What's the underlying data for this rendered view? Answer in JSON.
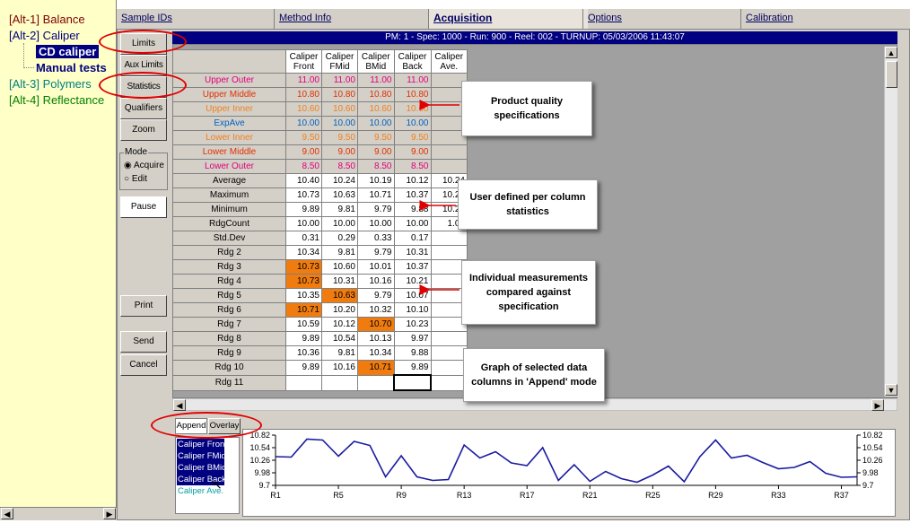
{
  "tree": [
    {
      "label": "[Alt-1] Balance",
      "color": "#800000"
    },
    {
      "label": "[Alt-2] Caliper",
      "color": "#000080"
    },
    {
      "label": "CD caliper",
      "color": "#ffffff",
      "selected": true
    },
    {
      "label": "Manual tests",
      "color": "#000080"
    },
    {
      "label": "[Alt-3] Polymers",
      "color": "#008080"
    },
    {
      "label": "[Alt-4] Reflectance",
      "color": "#008000"
    }
  ],
  "tabs": [
    "Sample IDs",
    "Method Info",
    "Acquisition",
    "Options",
    "Calibration"
  ],
  "buttons": {
    "limits": "Limits",
    "aux_limits": "Aux Limits",
    "statistics": "Statistics",
    "qualifiers": "Qualifiers",
    "zoom": "Zoom",
    "mode_label": "Mode",
    "acquire": "Acquire",
    "edit": "Edit",
    "pause": "Pause",
    "print": "Print",
    "send": "Send",
    "cancel": "Cancel",
    "append": "Append",
    "overlay": "Overlay"
  },
  "status_bar": "PM: 1 - Spec: 1000 - Run: 900 - Reel: 002 - TURNUP: 05/03/2006 11:43:07",
  "columns": [
    {
      "l1": "Caliper",
      "l2": "Front"
    },
    {
      "l1": "Caliper",
      "l2": "FMid"
    },
    {
      "l1": "Caliper",
      "l2": "BMid"
    },
    {
      "l1": "Caliper",
      "l2": "Back"
    },
    {
      "l1": "Caliper",
      "l2": "Ave."
    }
  ],
  "spec_rows": [
    {
      "label": "Upper Outer",
      "color": "#e0007a",
      "values": [
        "11.00",
        "11.00",
        "11.00",
        "11.00",
        ""
      ]
    },
    {
      "label": "Upper Middle",
      "color": "#e03000",
      "values": [
        "10.80",
        "10.80",
        "10.80",
        "10.80",
        ""
      ]
    },
    {
      "label": "Upper Inner",
      "color": "#f08020",
      "values": [
        "10.60",
        "10.60",
        "10.60",
        "10.60",
        ""
      ]
    },
    {
      "label": "ExpAve",
      "color": "#0060c0",
      "values": [
        "10.00",
        "10.00",
        "10.00",
        "10.00",
        ""
      ]
    },
    {
      "label": "Lower Inner",
      "color": "#f08020",
      "values": [
        "9.50",
        "9.50",
        "9.50",
        "9.50",
        ""
      ]
    },
    {
      "label": "Lower Middle",
      "color": "#e03000",
      "values": [
        "9.00",
        "9.00",
        "9.00",
        "9.00",
        ""
      ]
    },
    {
      "label": "Lower Outer",
      "color": "#e0007a",
      "values": [
        "8.50",
        "8.50",
        "8.50",
        "8.50",
        ""
      ]
    }
  ],
  "stat_rows": [
    {
      "label": "Average",
      "values": [
        "10.40",
        "10.24",
        "10.19",
        "10.12",
        "10.24"
      ]
    },
    {
      "label": "Maximum",
      "values": [
        "10.73",
        "10.63",
        "10.71",
        "10.37",
        "10.24"
      ]
    },
    {
      "label": "Minimum",
      "values": [
        "9.89",
        "9.81",
        "9.79",
        "9.88",
        "10.24"
      ]
    },
    {
      "label": "RdgCount",
      "values": [
        "10.00",
        "10.00",
        "10.00",
        "10.00",
        "1.00"
      ]
    },
    {
      "label": "Std.Dev",
      "values": [
        "0.31",
        "0.29",
        "0.33",
        "0.17",
        ""
      ]
    }
  ],
  "rdg_rows": [
    {
      "label": "Rdg 2",
      "values": [
        "10.34",
        "9.81",
        "9.79",
        "10.31",
        ""
      ],
      "hl": []
    },
    {
      "label": "Rdg 3",
      "values": [
        "10.73",
        "10.60",
        "10.01",
        "10.37",
        ""
      ],
      "hl": [
        0
      ]
    },
    {
      "label": "Rdg 4",
      "values": [
        "10.73",
        "10.31",
        "10.16",
        "10.21",
        ""
      ],
      "hl": [
        0
      ]
    },
    {
      "label": "Rdg 5",
      "values": [
        "10.35",
        "10.63",
        "9.79",
        "10.07",
        ""
      ],
      "hl": [
        1
      ]
    },
    {
      "label": "Rdg 6",
      "values": [
        "10.71",
        "10.20",
        "10.32",
        "10.10",
        ""
      ],
      "hl": [
        0
      ]
    },
    {
      "label": "Rdg 7",
      "values": [
        "10.59",
        "10.12",
        "10.70",
        "10.23",
        ""
      ],
      "hl": [
        2
      ]
    },
    {
      "label": "Rdg 8",
      "values": [
        "9.89",
        "10.54",
        "10.13",
        "9.97",
        ""
      ],
      "hl": []
    },
    {
      "label": "Rdg 9",
      "values": [
        "10.36",
        "9.81",
        "10.34",
        "9.88",
        ""
      ],
      "hl": []
    },
    {
      "label": "Rdg 10",
      "values": [
        "9.89",
        "10.16",
        "10.71",
        "9.89",
        ""
      ],
      "hl": [
        2
      ]
    },
    {
      "label": "Rdg 11",
      "values": [
        "",
        "",
        "",
        "",
        ""
      ],
      "hl": []
    }
  ],
  "highlight_color": "#f07c10",
  "callouts": {
    "spec": "Product quality specifications",
    "stats": "User defined per column statistics",
    "meas": "Individual measurements compared against specification",
    "graph": "Graph of selected data columns in 'Append' mode"
  },
  "legend": [
    {
      "label": "Caliper Front",
      "selected": true
    },
    {
      "label": "Caliper FMid",
      "selected": true
    },
    {
      "label": "Caliper BMid",
      "selected": true
    },
    {
      "label": "Caliper Back",
      "selected": true
    },
    {
      "label": "Caliper Ave.",
      "selected": false
    }
  ],
  "chart_data": {
    "type": "line",
    "ylim": [
      9.7,
      10.82
    ],
    "yticks": [
      "10.82",
      "10.54",
      "10.26",
      "9.98",
      "9.7"
    ],
    "xticks": [
      "R1",
      "R5",
      "R9",
      "R13",
      "R17",
      "R21",
      "R25",
      "R29",
      "R33",
      "R37"
    ],
    "series": [
      {
        "values": [
          10.34,
          10.33,
          10.73,
          10.71,
          10.35,
          10.68,
          10.59,
          9.89,
          10.36,
          9.89,
          9.81,
          9.83,
          10.6,
          10.31,
          10.45,
          10.2,
          10.14,
          10.54,
          9.81,
          10.16,
          9.79,
          10.01,
          9.85,
          9.77,
          9.93,
          10.13,
          9.78,
          10.34,
          10.71,
          10.31,
          10.37,
          10.21,
          10.07,
          10.1,
          10.23,
          9.97,
          9.88,
          9.89
        ]
      }
    ],
    "color": "#1a1aa0"
  }
}
